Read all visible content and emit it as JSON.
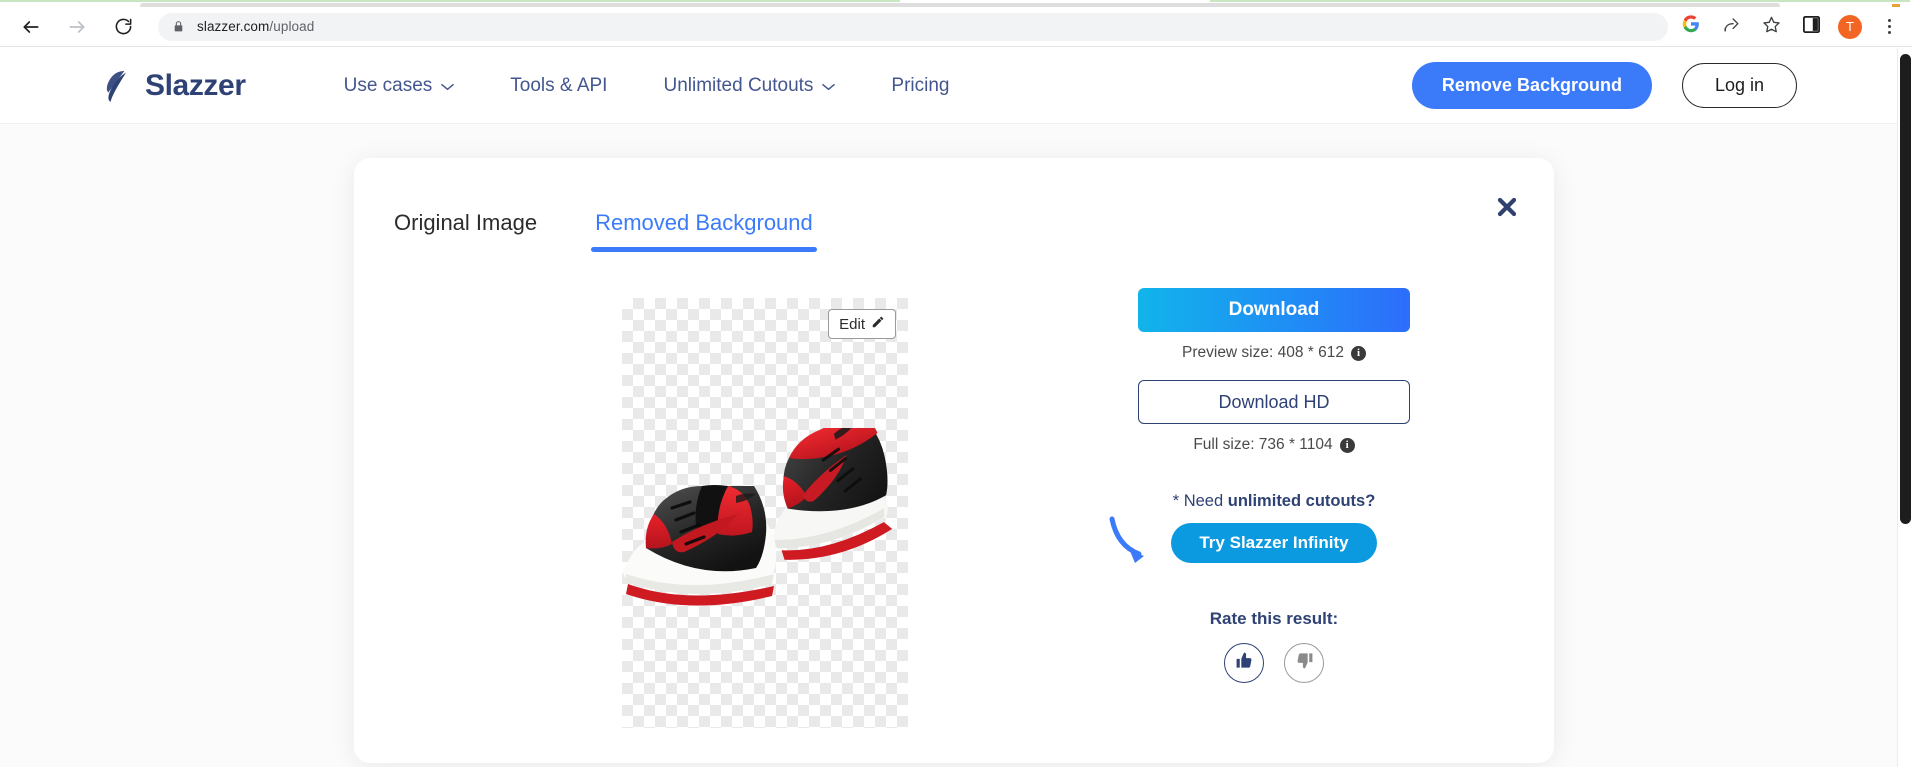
{
  "browser": {
    "back_icon": "arrow-left-icon",
    "forward_icon": "arrow-right-icon",
    "reload_icon": "reload-icon",
    "lock_icon": "lock-icon",
    "url_main": "slazzer.com",
    "url_path": "/upload",
    "google_icon": "google-icon",
    "share_icon": "share-icon",
    "bookmark_icon": "star-icon",
    "sidepanel_icon": "side-panel-icon",
    "avatar_initial": "T",
    "menu_icon": "three-dot-menu-icon"
  },
  "header": {
    "brand": "Slazzer",
    "logo_icon": "slazzer-logo-icon",
    "nav": [
      {
        "label": "Use cases",
        "has_chevron": true
      },
      {
        "label": "Tools & API",
        "has_chevron": false
      },
      {
        "label": "Unlimited Cutouts",
        "has_chevron": true
      },
      {
        "label": "Pricing",
        "has_chevron": false
      }
    ],
    "remove_background_label": "Remove Background",
    "login_label": "Log in"
  },
  "card": {
    "close_icon": "close-icon",
    "tabs": [
      {
        "label": "Original Image",
        "active": false
      },
      {
        "label": "Removed Background",
        "active": true
      }
    ],
    "edit_label": "Edit",
    "edit_icon": "pencil-icon",
    "preview_image_alt": "red-and-black-sneakers-cutout"
  },
  "actions": {
    "download_label": "Download",
    "preview_size_label": "Preview size: 408 * 612",
    "preview_info_icon": "info-icon",
    "download_hd_label": "Download HD",
    "full_size_label": "Full size: 736 * 1104",
    "full_info_icon": "info-icon",
    "need_prefix": "* Need ",
    "need_bold": "unlimited cutouts?",
    "arrow_icon": "curved-arrow-icon",
    "infinity_label": "Try Slazzer Infinity",
    "rate_title": "Rate this result:",
    "thumbs_up_icon": "thumbs-up-icon",
    "thumbs_down_icon": "thumbs-down-icon"
  },
  "colors": {
    "accent_blue": "#3b7bfa",
    "brand_navy": "#2f4275",
    "infinity_blue": "#0b9ae0",
    "avatar_orange": "#f26522"
  }
}
